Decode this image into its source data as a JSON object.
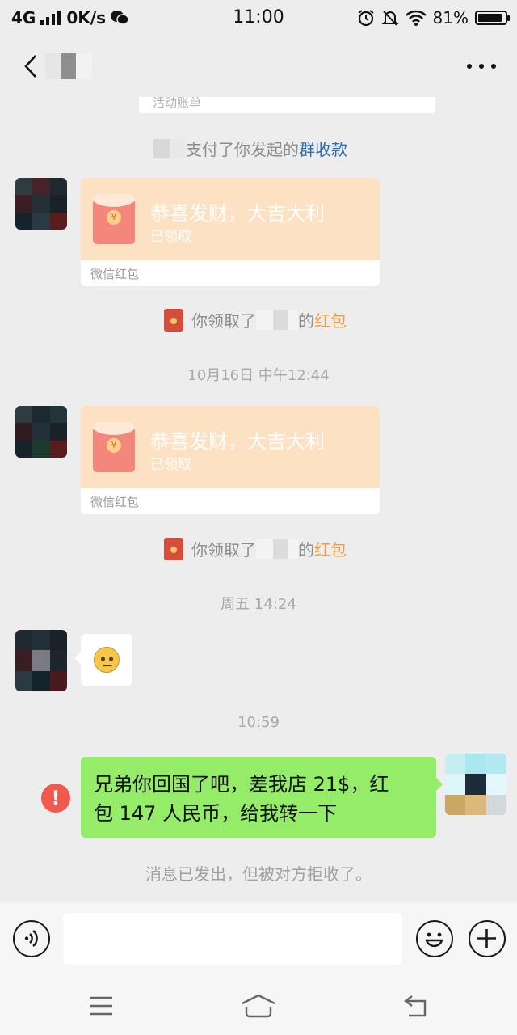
{
  "status_bar": {
    "network": "4G",
    "speed": "0K/s",
    "time": "11:00",
    "battery": "81%",
    "battery_level": 0.81
  },
  "nav": {
    "back_icon": "chevron-left-icon",
    "more_icon": "more-dots-icon"
  },
  "messages": {
    "prev_card_footer": "活动账单",
    "group_payment": {
      "prefix": "支付了你发起的",
      "link": "群收款"
    },
    "red_packet_1": {
      "title": "恭喜发财，大吉大利",
      "status": "已领取",
      "footer": "微信红包"
    },
    "claim_1": {
      "prefix": "你领取了",
      "suffix": "的",
      "link": "红包"
    },
    "time_1": "10月16日 中午12:44",
    "red_packet_2": {
      "title": "恭喜发财，大吉大利",
      "status": "已领取",
      "footer": "微信红包"
    },
    "claim_2": {
      "prefix": "你领取了",
      "suffix": "的",
      "link": "红包"
    },
    "time_2": "周五 14:24",
    "time_3": "10:59",
    "outgoing": {
      "line1": "兄弟你回国了吧，差我店 21$，红",
      "line2": "包 147 人民币，给我转一下",
      "error_mark": "!"
    },
    "reject_notice": "消息已发出，但被对方拒收了。"
  },
  "colors": {
    "green_bubble": "#95ec69",
    "red_packet": "#fde1c3",
    "link_blue": "#2a6fb5",
    "link_orange": "#f29b38"
  }
}
